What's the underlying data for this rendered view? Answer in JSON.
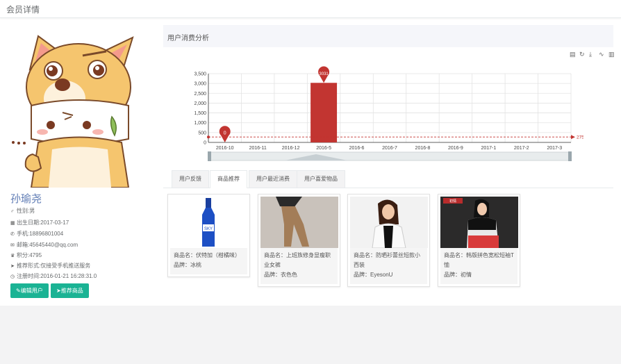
{
  "header": {
    "title": "会员详情"
  },
  "profile": {
    "name": "孙瑜尧",
    "gender": "性别:男",
    "birthday": "出生日期:2017-03-17",
    "phone": "手机:18896801004",
    "email": "邮箱:45645440@qq.com",
    "points": "积分:4795",
    "push": "推荐形式:仅接受手机推送服务",
    "registered": "注册时间:2016-01-21 16:28:31.0",
    "edit_button": "编辑用户",
    "recommend_button": "推荐商品"
  },
  "analysis": {
    "title": "用户消费分析"
  },
  "toolbox": {
    "icons": [
      "data-view-icon",
      "refresh-icon",
      "download-icon",
      "line-chart-icon",
      "bar-chart-icon"
    ]
  },
  "chart_data": {
    "type": "bar",
    "categories": [
      "2016-10",
      "2016-11",
      "2016-12",
      "2016-5",
      "2016-6",
      "2016-7",
      "2016-8",
      "2016-9",
      "2017-1",
      "2017-2",
      "2017-3"
    ],
    "values": [
      0,
      0,
      0,
      3031,
      0,
      0,
      0,
      0,
      0,
      0,
      0
    ],
    "ylim": [
      0,
      3500
    ],
    "yticks": [
      "0",
      "500",
      "1,000",
      "1,500",
      "2,000",
      "2,500",
      "3,000",
      "3,500"
    ],
    "markpoints": [
      {
        "category": "2016-10",
        "value": 0,
        "label": "0"
      },
      {
        "category": "2016-5",
        "value": 3031,
        "label": "3031"
      }
    ],
    "markline": {
      "value": 275.55,
      "label": "275.55"
    },
    "bar_color": "#c23531",
    "grid": true
  },
  "tabs": [
    {
      "label": "用户反馈",
      "active": false
    },
    {
      "label": "商品推荐",
      "active": true
    },
    {
      "label": "用户最近消费",
      "active": false
    },
    {
      "label": "用户喜爱物品",
      "active": false
    }
  ],
  "products": [
    {
      "name": "商品名：伏特加（柑橘味）",
      "brand": "品牌：冰桃"
    },
    {
      "name": "商品名：上班族修身显瘦职业女裤",
      "brand": "品牌：衣色色"
    },
    {
      "name": "商品名：防晒衫蕾丝短款小西装",
      "brand": "品牌：EyesonU"
    },
    {
      "name": "商品名：韩版拼色宽松短袖T恤",
      "brand": "品牌：初情"
    }
  ],
  "product_badge": "初情"
}
